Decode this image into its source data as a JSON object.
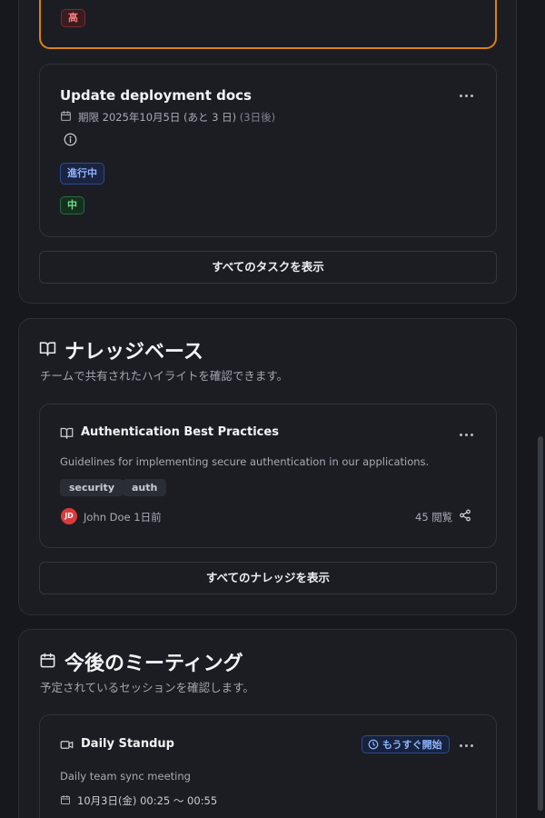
{
  "tasks_section": {
    "highlight_task": {
      "priority": "高"
    },
    "task": {
      "title": "Update deployment docs",
      "due_label": "期限 2025年10月5日 (あと 3 日)",
      "due_relative": "(3日後)",
      "status": "進行中",
      "priority": "中"
    },
    "view_all": "すべてのタスクを表示"
  },
  "knowledge_section": {
    "title": "ナレッジベース",
    "subtitle": "チームで共有されたハイライトを確認できます。",
    "article": {
      "title": "Authentication Best Practices",
      "description": "Guidelines for implementing secure authentication in our applications.",
      "tags": [
        "security",
        "auth"
      ],
      "author_initials": "JD",
      "author_meta": "John Doe 1日前",
      "views": "45 閲覧"
    },
    "view_all": "すべてのナレッジを表示"
  },
  "meetings_section": {
    "title": "今後のミーティング",
    "subtitle": "予定されているセッションを確認します。",
    "meeting": {
      "title": "Daily Standup",
      "badge": "もうすぐ開始",
      "description": "Daily team sync meeting",
      "time": "10月3日(金) 00:25 〜 00:55"
    }
  },
  "colors": {
    "background": "#17181d",
    "card": "#1c1d23",
    "highlight_border": "#d9830f",
    "accent_blue": "#8fb4ff",
    "accent_green": "#6fdc8f",
    "accent_red": "#f27a7a",
    "avatar": "#d83b3b"
  },
  "icons": [
    "calendar-icon",
    "info-icon",
    "book-open-icon",
    "share-icon",
    "video-icon",
    "clock-icon",
    "more-horizontal-icon"
  ]
}
